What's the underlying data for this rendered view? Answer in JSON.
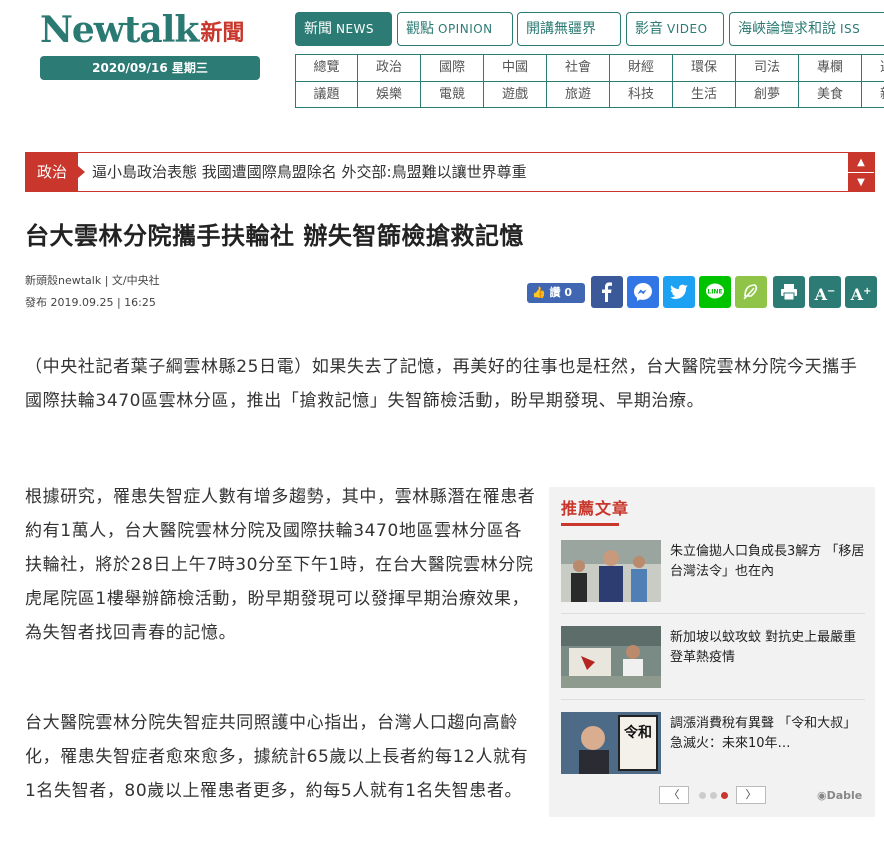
{
  "header": {
    "logo_latin": "Newtalk",
    "logo_cjk": "新聞",
    "date": "2020/09/16 星期三"
  },
  "top_tabs": [
    {
      "label": "新聞",
      "en": "NEWS"
    },
    {
      "label": "觀點",
      "en": "OPINION"
    },
    {
      "label": "開講無疆界",
      "en": ""
    },
    {
      "label": "影音",
      "en": "VIDEO"
    },
    {
      "label": "海峽論壇求和說",
      "en": "ISS"
    }
  ],
  "categories_row1": [
    "總覽",
    "政治",
    "國際",
    "中國",
    "社會",
    "財經",
    "環保",
    "司法",
    "專欄",
    "選舉"
  ],
  "categories_row2": [
    "議題",
    "娛樂",
    "電競",
    "遊戲",
    "旅遊",
    "科技",
    "生活",
    "創夢",
    "美食",
    "新奇"
  ],
  "ticker": {
    "tag": "政治",
    "text": "逼小島政治表態 我國遭國際鳥盟除名 外交部:鳥盟難以讓世界尊重",
    "up": "▲",
    "down": "▼"
  },
  "article": {
    "headline": "台大雲林分院攜手扶輪社 辦失智篩檢搶救記憶",
    "byline": "新頭殼newtalk | 文/中央社",
    "published": "發布 2019.09.25 | 16:25",
    "like_label": "讚 0",
    "paragraphs": [
      "（中央社記者葉子綱雲林縣25日電）如果失去了記憶，再美好的往事也是枉然，台大醫院雲林分院今天攜手國際扶輪3470區雲林分區，推出「搶救記憶」失智篩檢活動，盼早期發現、早期治療。",
      "根據研究，罹患失智症人數有增多趨勢，其中，雲林縣潛在罹患者約有1萬人，台大醫院雲林分院及國際扶輪3470地區雲林分區各扶輪社，將於28日上午7時30分至下午1時，在台大醫院雲林分院虎尾院區1樓舉辦篩檢活動，盼早期發現可以發揮早期治療效果，為失智者找回青春的記憶。",
      "台大醫院雲林分院失智症共同照護中心指出，台灣人口趨向高齡化，罹患失智症者愈來愈多，據統計65歲以上長者約每12人就有1名失智者，80歲以上罹患者更多，約每5人就有1名失智患者。"
    ]
  },
  "share_icons": [
    "facebook-icon",
    "messenger-icon",
    "twitter-icon",
    "line-icon",
    "plurk-icon",
    "print-icon",
    "font-smaller-icon",
    "font-larger-icon"
  ],
  "share_glyphs": {
    "font_smaller": "A",
    "font_larger": "A"
  },
  "recommended": {
    "title": "推薦文章",
    "items": [
      {
        "text": "朱立倫拋人口負成長3解方 「移居台灣法令」也在內"
      },
      {
        "text": "新加坡以蚊攻蚊 對抗史上最嚴重登革熱疫情"
      },
      {
        "text": "調漲消費稅有異聲 「令和大叔」急滅火：未來10年…"
      }
    ],
    "thumb3_sign": "令和",
    "prev": "〈",
    "next": "〉",
    "powered_by": "Dable"
  },
  "colors": {
    "brand_teal": "#2c7b74",
    "brand_red": "#c9362c"
  }
}
